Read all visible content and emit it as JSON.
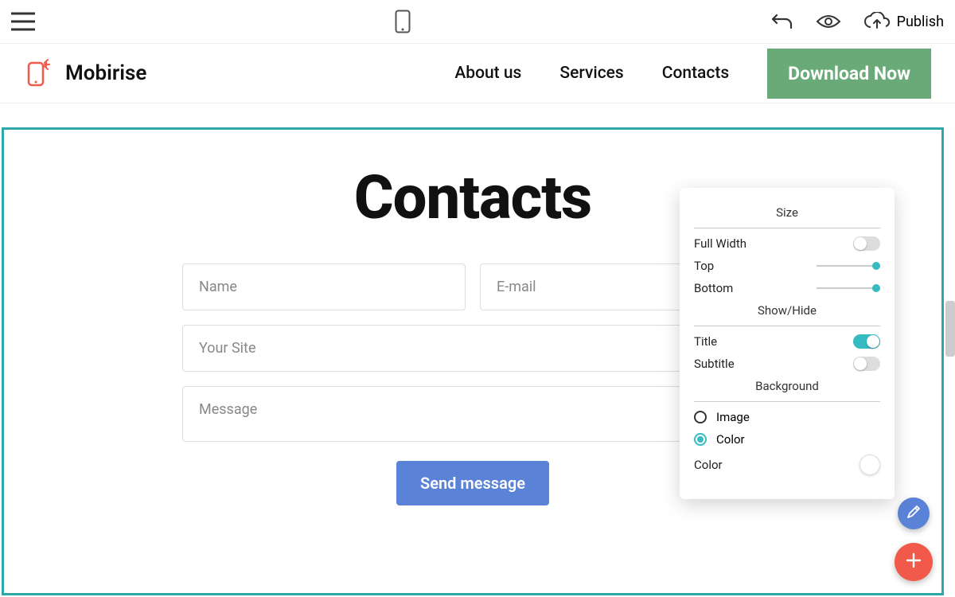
{
  "appbar": {
    "publish_label": "Publish"
  },
  "site": {
    "brand": "Mobirise",
    "nav": {
      "about": "About us",
      "services": "Services",
      "contacts": "Contacts"
    },
    "download_btn": "Download Now"
  },
  "contacts": {
    "title": "Contacts",
    "name_placeholder": "Name",
    "email_placeholder": "E-mail",
    "site_placeholder": "Your Site",
    "message_placeholder": "Message",
    "send_btn": "Send message"
  },
  "popover": {
    "size_title": "Size",
    "full_width": "Full Width",
    "top": "Top",
    "bottom": "Bottom",
    "showhide_title": "Show/Hide",
    "title_label": "Title",
    "subtitle_label": "Subtitle",
    "background_title": "Background",
    "bg_image": "Image",
    "bg_color": "Color",
    "color_label": "Color",
    "full_width_on": false,
    "title_on": true,
    "subtitle_on": false,
    "bg_selected": "color",
    "swatch_color": "#ffffff"
  }
}
